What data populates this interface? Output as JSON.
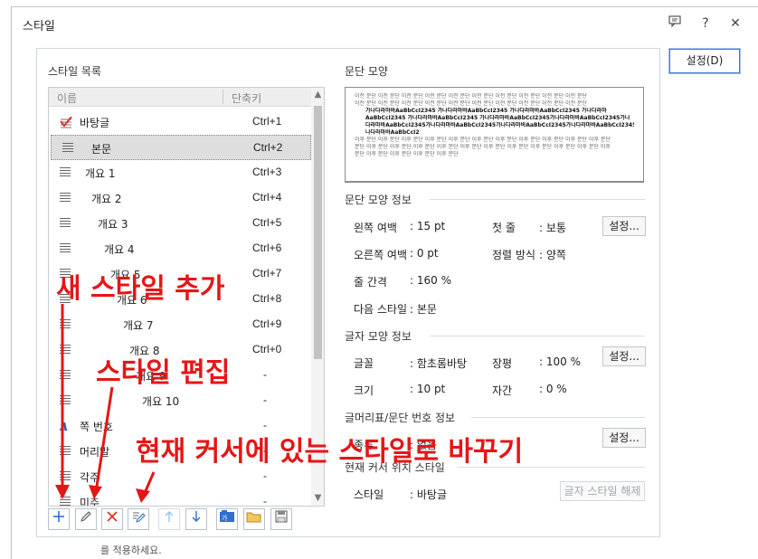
{
  "dialog": {
    "title": "스타일",
    "help": "?",
    "close": "✕"
  },
  "style_list": {
    "section_title": "스타일 목록",
    "col_name": "이름",
    "col_shortcut": "단축키",
    "items": [
      {
        "name": "바탕글",
        "key": "Ctrl+1"
      },
      {
        "name": "본문",
        "key": "Ctrl+2"
      },
      {
        "name": "개요  1",
        "key": "Ctrl+3"
      },
      {
        "name": "개요  2",
        "key": "Ctrl+4"
      },
      {
        "name": "개요  3",
        "key": "Ctrl+5"
      },
      {
        "name": "개요  4",
        "key": "Ctrl+6"
      },
      {
        "name": "개요  5",
        "key": "Ctrl+7"
      },
      {
        "name": "개요  6",
        "key": "Ctrl+8"
      },
      {
        "name": "개요  7",
        "key": "Ctrl+9"
      },
      {
        "name": "개요  8",
        "key": "Ctrl+0"
      },
      {
        "name": "개요  9",
        "key": "-"
      },
      {
        "name": "개요  10",
        "key": "-"
      },
      {
        "name": "쪽 번호",
        "key": "-"
      },
      {
        "name": "머리말",
        "key": "-"
      },
      {
        "name": "각주",
        "key": "-"
      },
      {
        "name": "미주",
        "key": "-"
      }
    ]
  },
  "preview": {
    "section_title": "문단 모양",
    "line_before": "이전 문단 이전 문단 이전 문단 이전 문단 이전 문단 이전 문단 이전 문단 이전 문단 이전 문단 이전 문단",
    "sample_1": "가나다라마바AaBbCcI2345     가나다라마바AaBbCcI2345     가나다라마바AaBbCcI2345     가나다라마",
    "sample_2": "AaBbCcI2345  가나다라마바AaBbCcI2345  가나다라마바AaBbCcI2345가나다라마바AaBbCcI2345가나",
    "sample_3": "다라마바AaBbCcI2345가나다라마바AaBbCcI2345가나다라마바AaBbCcI2345가나다라마바AaBbCcI2345가",
    "sample_4": "나다라마바AaBbCcI2",
    "line_after_1": "이후 문단 이후 문단 이후 문단 이후 문단 이후 문단 이후 문단 이후 문단 이후 문단 이후 문단 이후 문단 이후 문단",
    "line_after_2": "문단 이후 문단 이후 문단 이후 문단 이후 문단 이후 문단 이후 문단 이후 문단 이후 문단 이후 문단 이후 문단 이후",
    "line_after_3": "문단 이후 문단 이후 문단 이후 문단 이후 문단"
  },
  "paragraph_info": {
    "section_title": "문단 모양 정보",
    "left_margin_label": "왼쪽 여백",
    "left_margin_value": ": 15 pt",
    "first_line_label": "첫 줄",
    "first_line_value": ": 보통",
    "right_margin_label": "오른쪽 여백",
    "right_margin_value": ": 0 pt",
    "align_label": "정렬 방식",
    "align_value": ": 양쪽",
    "line_spacing_label": "줄 간격",
    "line_spacing_value": ": 160 %",
    "next_style_label": "다음 스타일",
    "next_style_value": ": 본문",
    "settings_label": "설정..."
  },
  "char_info": {
    "section_title": "글자 모양 정보",
    "font_label": "글꼴",
    "font_value": ": 함초롬바탕",
    "width_label": "장평",
    "width_value": ": 100 %",
    "size_label": "크기",
    "size_value": ": 10 pt",
    "spacing_label": "자간",
    "spacing_value": ": 0 %",
    "settings_label": "설정..."
  },
  "bullet_info": {
    "section_title": "글머리표/문단 번호 정보",
    "type_label": "종류",
    "type_value": ": 없음",
    "settings_label": "설정..."
  },
  "cursor_info": {
    "section_title": "현재 커서 위치 스타일",
    "style_label": "스타일",
    "style_value": ": 바탕글",
    "release_label": "글자 스타일 해제"
  },
  "main_button": "설정(D)",
  "footer_text": "를 적용하세요.",
  "annotations": {
    "add_style": "새 스타일 추가",
    "edit_style": "스타일 편집",
    "change_to_current": "현재 커서에 있는 스타일로 바꾸기"
  },
  "colors": {
    "annotation": "#e51616",
    "accent": "#3b7ad9"
  }
}
